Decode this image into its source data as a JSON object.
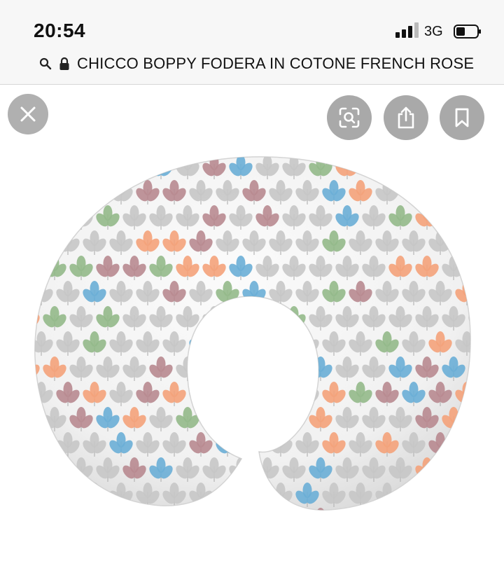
{
  "status": {
    "time": "20:54",
    "network": "3G"
  },
  "url_bar": {
    "title": "CHICCO BOPPY FODERA IN COTONE FRENCH ROSE"
  },
  "icons": [
    "search-icon",
    "lock-icon",
    "close-icon",
    "lens-icon",
    "share-icon",
    "bookmark-icon",
    "signal-icon",
    "battery-icon"
  ],
  "colors": {
    "bar_bg": "#f7f7f7",
    "button_bg": "#a9a9a9",
    "leaf_gray": "#c7c7c7",
    "leaf_blue": "#6aaed6",
    "leaf_orange": "#f4a27a",
    "leaf_green": "#93b98a",
    "leaf_mauve": "#b88a90",
    "pillow_bg": "#f3f3f3"
  }
}
